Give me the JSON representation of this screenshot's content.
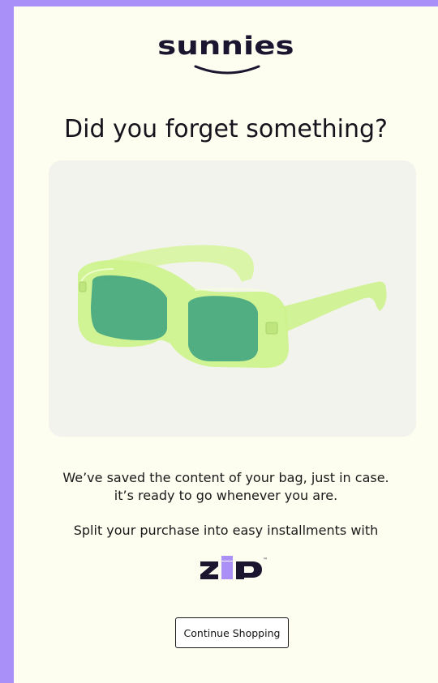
{
  "brand": {
    "name": "sunnies"
  },
  "headline": "Did you forget something?",
  "product": {
    "image_alt": "green rectangular sunglasses"
  },
  "message": {
    "line1": "We’ve saved the content of your bag, just in case.",
    "line2": "it’s ready to go whenever you are.",
    "installments": "Split your purchase into easy installments with"
  },
  "payment_partner": {
    "name": "zip",
    "trademark": "™"
  },
  "cta": {
    "label": "Continue Shopping"
  },
  "colors": {
    "frame": "#a98ff8",
    "background": "#fdfdf0",
    "brand_dark": "#1b1530",
    "zip_purple": "#aa8ff7",
    "lens_green": "#3fa37f",
    "frame_green": "#cdf28d"
  }
}
